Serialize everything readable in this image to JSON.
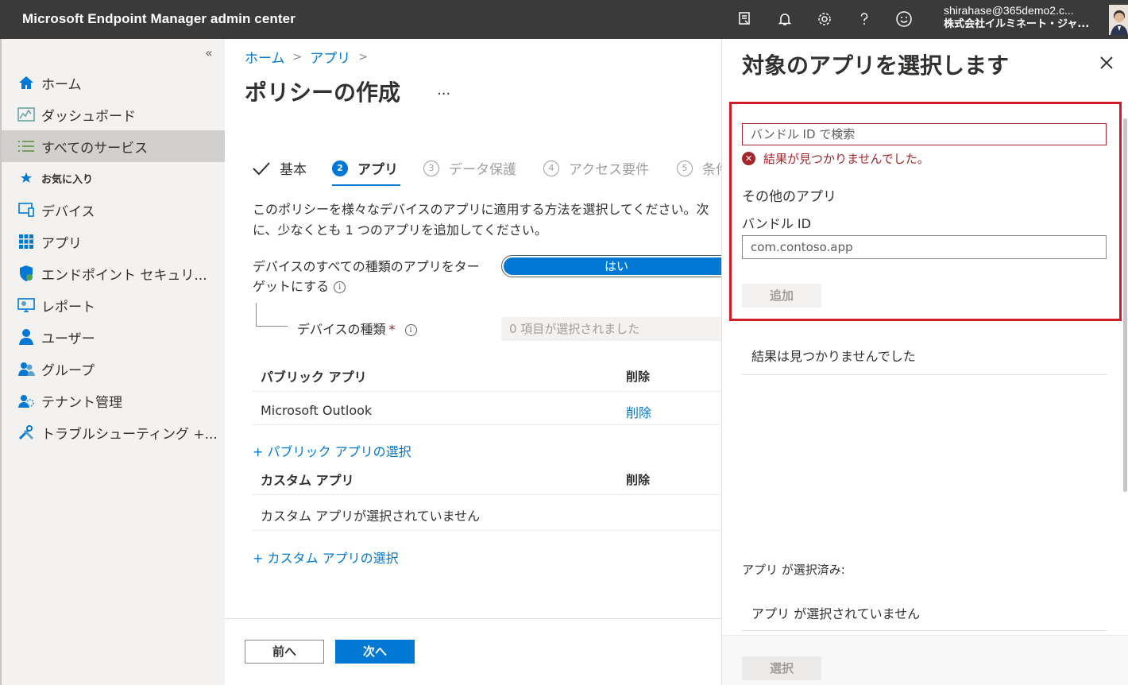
{
  "header": {
    "app_title": "Microsoft Endpoint Manager admin center",
    "user_email": "shirahase@365demo2.c...",
    "user_org": "株式会社イルミネート・ジャ..."
  },
  "sidebar": {
    "collapse_glyph": "«",
    "items": [
      {
        "label": "ホーム",
        "icon": "home-icon"
      },
      {
        "label": "ダッシュボード",
        "icon": "dashboard-icon"
      },
      {
        "label": "すべてのサービス",
        "icon": "list-icon"
      },
      {
        "label": "お気に入り",
        "icon": "star-icon"
      },
      {
        "label": "デバイス",
        "icon": "devices-icon"
      },
      {
        "label": "アプリ",
        "icon": "apps-icon"
      },
      {
        "label": "エンドポイント セキュリ...",
        "icon": "shield-icon"
      },
      {
        "label": "レポート",
        "icon": "report-icon"
      },
      {
        "label": "ユーザー",
        "icon": "user-icon"
      },
      {
        "label": "グループ",
        "icon": "group-icon"
      },
      {
        "label": "テナント管理",
        "icon": "tenant-icon"
      },
      {
        "label": "トラブルシューティング +...",
        "icon": "tools-icon"
      }
    ]
  },
  "main": {
    "breadcrumb": [
      "ホーム",
      "アプリ"
    ],
    "page_title": "ポリシーの作成",
    "more": "...",
    "steps": [
      {
        "num": "✓",
        "label": "基本"
      },
      {
        "num": "2",
        "label": "アプリ"
      },
      {
        "num": "3",
        "label": "データ保護"
      },
      {
        "num": "4",
        "label": "アクセス要件"
      },
      {
        "num": "5",
        "label": "条件"
      }
    ],
    "description": "このポリシーを様々なデバイスのアプリに適用する方法を選択してください。次に、少なくとも 1 つのアプリを追加してください。",
    "target_all_label": "デバイスのすべての種類のアプリをターゲットにする",
    "toggle_value": "はい",
    "device_type_label": "デバイスの種類",
    "required_mark": "*",
    "device_type_value": "0 項目が選択されました",
    "public_apps": {
      "header": "パブリック アプリ",
      "remove_header": "削除",
      "rows": [
        {
          "name": "Microsoft Outlook",
          "action": "削除"
        }
      ],
      "add_link": "+ パブリック アプリの選択"
    },
    "custom_apps": {
      "header": "カスタム アプリ",
      "remove_header": "削除",
      "empty": "カスタム アプリが選択されていません",
      "add_link": "+ カスタム アプリの選択"
    },
    "prev_button": "前へ",
    "next_button": "次へ"
  },
  "panel": {
    "title": "対象のアプリを選択します",
    "search_placeholder": "バンドル ID で検索",
    "error_text": "結果が見つかりませんでした。",
    "other_apps_title": "その他のアプリ",
    "bundle_id_label": "バンドル ID",
    "bundle_id_value": "com.contoso.app",
    "add_button": "追加",
    "no_results": "結果は見つかりませんでした",
    "selected_label": "アプリ が選択済み:",
    "none_selected": "アプリ が選択されていません",
    "select_button": "選択"
  },
  "colors": {
    "accent": "#0078d4",
    "highlight_border": "#d01c28",
    "error": "#a4262c",
    "topbar": "#3a3a3a"
  }
}
